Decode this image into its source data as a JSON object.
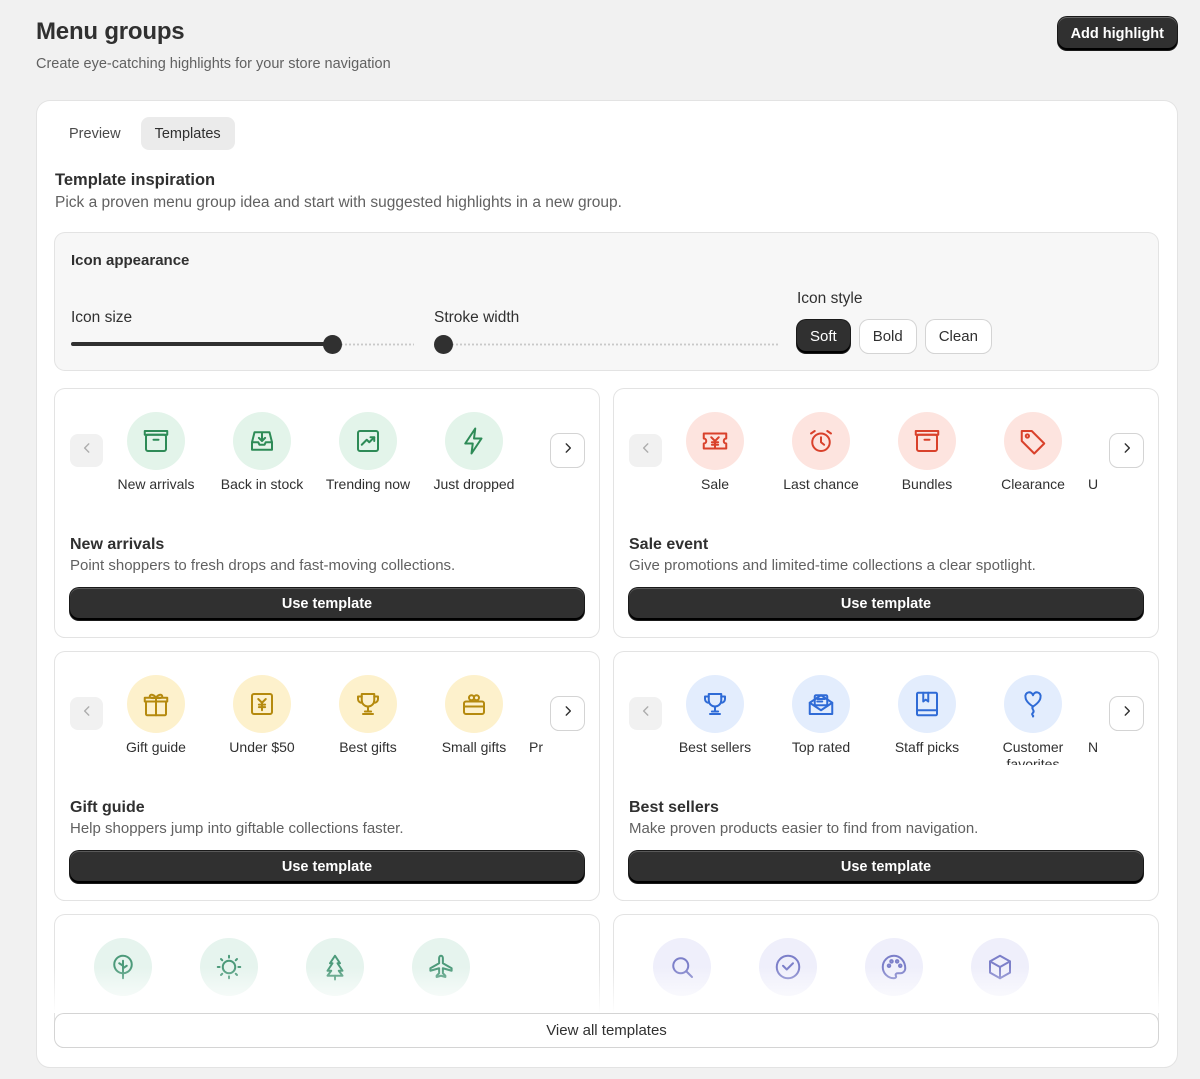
{
  "header": {
    "title": "Menu groups",
    "subtitle": "Create eye-catching highlights for your store navigation",
    "primary_action": "Add highlight"
  },
  "tabs": [
    {
      "label": "Preview",
      "active": false
    },
    {
      "label": "Templates",
      "active": true
    }
  ],
  "section": {
    "title": "Template inspiration",
    "description": "Pick a proven menu group idea and start with suggested highlights in a new group."
  },
  "appearance": {
    "title": "Icon appearance",
    "icon_size": {
      "label": "Icon size",
      "value": 0.76
    },
    "stroke_width": {
      "label": "Stroke width",
      "value": 0.0
    },
    "icon_style": {
      "label": "Icon style",
      "options": [
        "Soft",
        "Bold",
        "Clean"
      ],
      "selected": "Soft"
    }
  },
  "templates": [
    {
      "title": "New arrivals",
      "description": "Point shoppers to fresh drops and fast-moving collections.",
      "button": "Use template",
      "accent": "#2e8b57",
      "bg": "#e3f4ea",
      "items": [
        {
          "label": "New arrivals",
          "icon": "box-icon"
        },
        {
          "label": "Back in stock",
          "icon": "inbox-download-icon"
        },
        {
          "label": "Trending now",
          "icon": "trend-up-icon"
        },
        {
          "label": "Just dropped",
          "icon": "lightning-icon"
        }
      ]
    },
    {
      "title": "Sale event",
      "description": "Give promotions and limited-time collections a clear spotlight.",
      "button": "Use template",
      "accent": "#d9412b",
      "bg": "#fde4df",
      "items": [
        {
          "label": "Sale",
          "icon": "ticket-yen-icon"
        },
        {
          "label": "Last chance",
          "icon": "alarm-clock-icon"
        },
        {
          "label": "Bundles",
          "icon": "box-icon"
        },
        {
          "label": "Clearance",
          "icon": "price-tag-icon"
        },
        {
          "label": "U",
          "icon": "hidden-icon"
        }
      ]
    },
    {
      "title": "Gift guide",
      "description": "Help shoppers jump into giftable collections faster.",
      "button": "Use template",
      "accent": "#b58a0e",
      "bg": "#fdf1cc",
      "items": [
        {
          "label": "Gift guide",
          "icon": "gift-icon"
        },
        {
          "label": "Under $50",
          "icon": "price-yen-icon"
        },
        {
          "label": "Best gifts",
          "icon": "trophy-icon"
        },
        {
          "label": "Small gifts",
          "icon": "gift-box-icon"
        },
        {
          "label": "Pr",
          "icon": "hidden-icon"
        }
      ]
    },
    {
      "title": "Best sellers",
      "description": "Make proven products easier to find from navigation.",
      "button": "Use template",
      "accent": "#2f6bd6",
      "bg": "#e3edfd",
      "items": [
        {
          "label": "Best sellers",
          "icon": "trophy-icon"
        },
        {
          "label": "Top rated",
          "icon": "envelope-open-icon"
        },
        {
          "label": "Staff picks",
          "icon": "bookmark-book-icon"
        },
        {
          "label": "Customer favorites",
          "icon": "heart-balloon-icon"
        },
        {
          "label": "N",
          "icon": "hidden-icon"
        }
      ]
    }
  ],
  "partial_templates": [
    {
      "accent": "#4c9a7a",
      "bg": "#e6f4ee",
      "icons": [
        "tree-icon",
        "sun-icon",
        "pine-tree-icon",
        "airplane-icon"
      ]
    },
    {
      "accent": "#7c7fc9",
      "bg": "#efeffb",
      "icons": [
        "search-icon",
        "heart-check-icon",
        "palette-icon",
        "cube-icon"
      ]
    }
  ],
  "footer": {
    "view_all": "View all templates"
  }
}
